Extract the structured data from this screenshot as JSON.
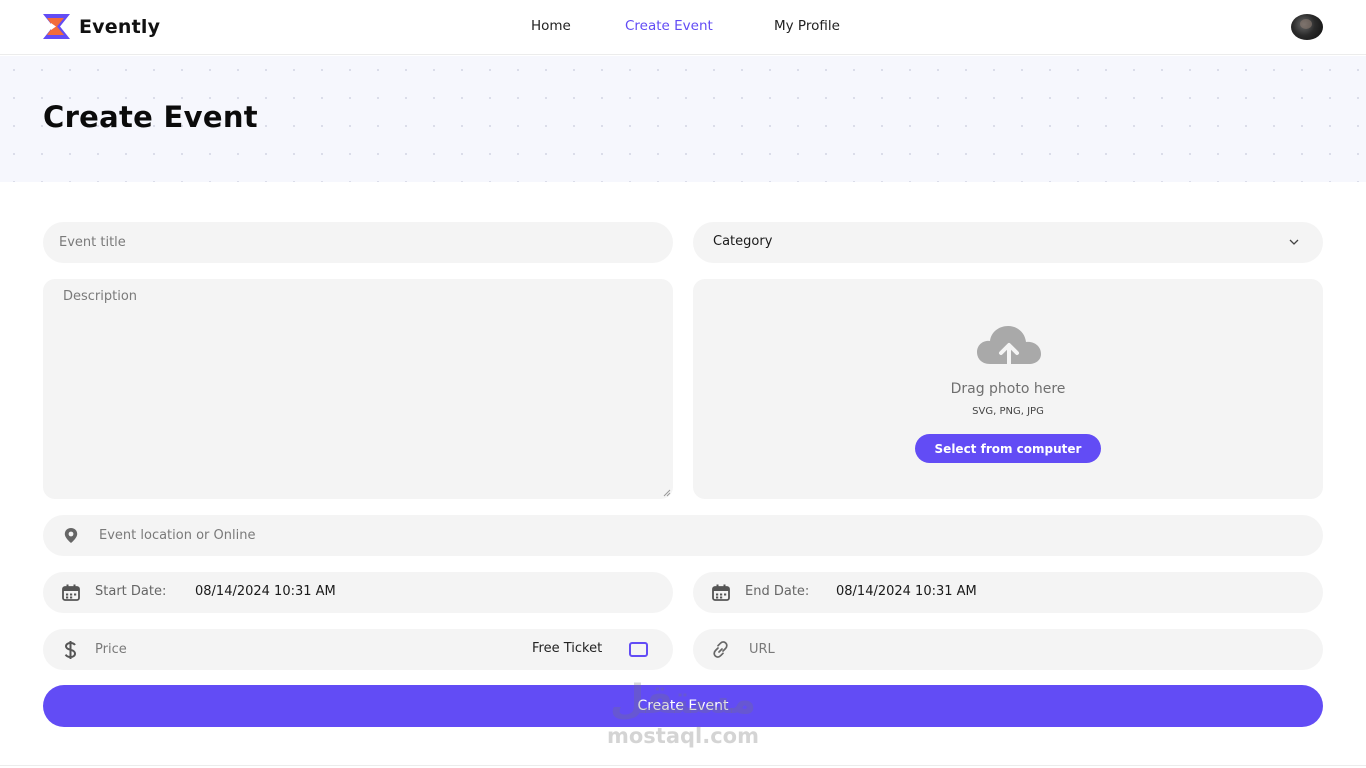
{
  "brand": {
    "name": "Evently",
    "accent": "#624cf5",
    "logo_colors": [
      "#624cf5",
      "#f26b3a"
    ]
  },
  "nav": {
    "items": [
      {
        "label": "Home",
        "active": false
      },
      {
        "label": "Create Event",
        "active": true
      },
      {
        "label": "My Profile",
        "active": false
      }
    ]
  },
  "page": {
    "title": "Create Event"
  },
  "form": {
    "event_title_placeholder": "Event title",
    "category": {
      "selected": "Category"
    },
    "description_placeholder": "Description",
    "upload": {
      "title": "Drag photo here",
      "formats": "SVG, PNG, JPG",
      "button": "Select from computer",
      "icon": "cloud-upload-icon"
    },
    "location_placeholder": "Event location or Online",
    "start_date": {
      "label": "Start Date:",
      "value": "08/14/2024 10:31 AM"
    },
    "end_date": {
      "label": "End Date:",
      "value": "08/14/2024 10:31 AM"
    },
    "price_placeholder": "Price",
    "free_ticket": {
      "label": "Free Ticket",
      "checked": false
    },
    "url_placeholder": "URL",
    "submit": "Create Event"
  },
  "watermark": {
    "arabic": "مستقل",
    "latin": "mostaql.com"
  }
}
